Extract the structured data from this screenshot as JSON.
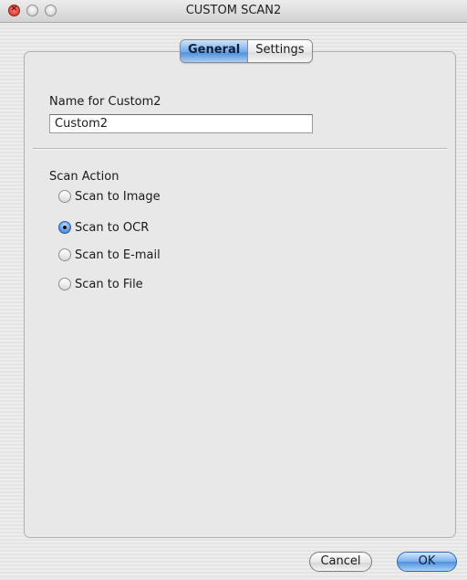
{
  "window": {
    "title": "CUSTOM SCAN2",
    "close_glyph": "×"
  },
  "tabs": [
    {
      "label": "General",
      "active": true
    },
    {
      "label": "Settings",
      "active": false
    }
  ],
  "name_section": {
    "label": "Name for Custom2",
    "value": "Custom2"
  },
  "scan_action": {
    "label": "Scan Action",
    "options": [
      {
        "label": "Scan to Image",
        "selected": false
      },
      {
        "label": "Scan to OCR",
        "selected": true
      },
      {
        "label": "Scan to E-mail",
        "selected": false
      },
      {
        "label": "Scan to File",
        "selected": false
      }
    ]
  },
  "buttons": {
    "cancel": "Cancel",
    "ok": "OK"
  },
  "icons": {
    "close": "close-icon",
    "minimize": "minimize-icon",
    "zoom": "zoom-icon"
  },
  "colors": {
    "accent": "#5c98e2",
    "close": "#c8281c"
  }
}
